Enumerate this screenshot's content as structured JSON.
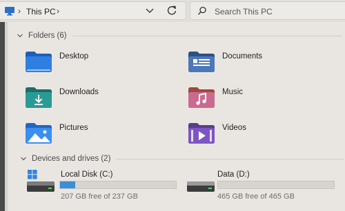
{
  "address": {
    "crumb": "This PC",
    "search_placeholder": "Search This PC"
  },
  "sections": {
    "folders": {
      "title": "Folders (6)"
    },
    "drives": {
      "title": "Devices and drives (2)"
    }
  },
  "folders": [
    {
      "label": "Desktop"
    },
    {
      "label": "Documents"
    },
    {
      "label": "Downloads"
    },
    {
      "label": "Music"
    },
    {
      "label": "Pictures"
    },
    {
      "label": "Videos"
    }
  ],
  "drives": [
    {
      "label": "Local Disk (C:)",
      "free_text": "207 GB free of 237 GB",
      "used_fraction": 0.13
    },
    {
      "label": "Data (D:)",
      "free_text": "465 GB free of 465 GB",
      "used_fraction": 0.0
    }
  ],
  "colors": {
    "accent": "#3b8fd6"
  }
}
